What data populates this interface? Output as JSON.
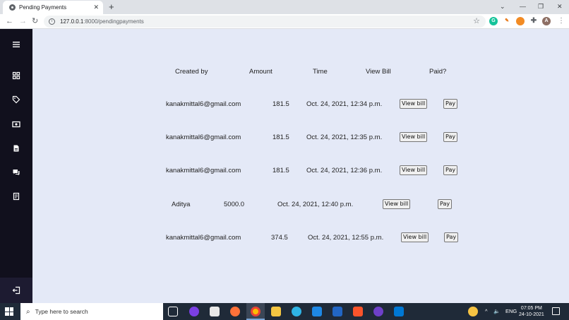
{
  "browser": {
    "tab_title": "Pending Payments",
    "url_host": "127.0.0.1",
    "url_path": ":8000/pendingpayments",
    "new_tab": "+",
    "tab_close": "✕",
    "profile_initial": "A",
    "extension_g": "G"
  },
  "sidebar": {
    "icons": [
      "menu-icon",
      "grid-icon",
      "tag-icon",
      "money-icon",
      "document-icon",
      "chat-icon",
      "receipt-icon",
      "logout-icon"
    ]
  },
  "table": {
    "headers": [
      "Created by",
      "Amount",
      "Time",
      "View Bill",
      "Paid?"
    ],
    "rows": [
      {
        "created_by": "kanakmittal6@gmail.com",
        "amount": "181.5",
        "time": "Oct. 24, 2021, 12:34 p.m.",
        "view_bill": "View bill",
        "pay": "Pay"
      },
      {
        "created_by": "kanakmittal6@gmail.com",
        "amount": "181.5",
        "time": "Oct. 24, 2021, 12:35 p.m.",
        "view_bill": "View bill",
        "pay": "Pay"
      },
      {
        "created_by": "kanakmittal6@gmail.com",
        "amount": "181.5",
        "time": "Oct. 24, 2021, 12:36 p.m.",
        "view_bill": "View bill",
        "pay": "Pay"
      },
      {
        "created_by": "Aditya",
        "amount": "5000.0",
        "time": "Oct. 24, 2021, 12:40 p.m.",
        "view_bill": "View bill",
        "pay": "Pay"
      },
      {
        "created_by": "kanakmittal6@gmail.com",
        "amount": "374.5",
        "time": "Oct. 24, 2021, 12:55 p.m.",
        "view_bill": "View bill",
        "pay": "Pay"
      }
    ]
  },
  "taskbar": {
    "search_placeholder": "Type here to search",
    "language": "ENG",
    "time": "07:05 PM",
    "date": "24-10-2021"
  },
  "colors": {
    "sidebar_bg": "#11101d",
    "page_bg": "#e4e9f7",
    "taskbar_bg": "#1f2a38"
  }
}
